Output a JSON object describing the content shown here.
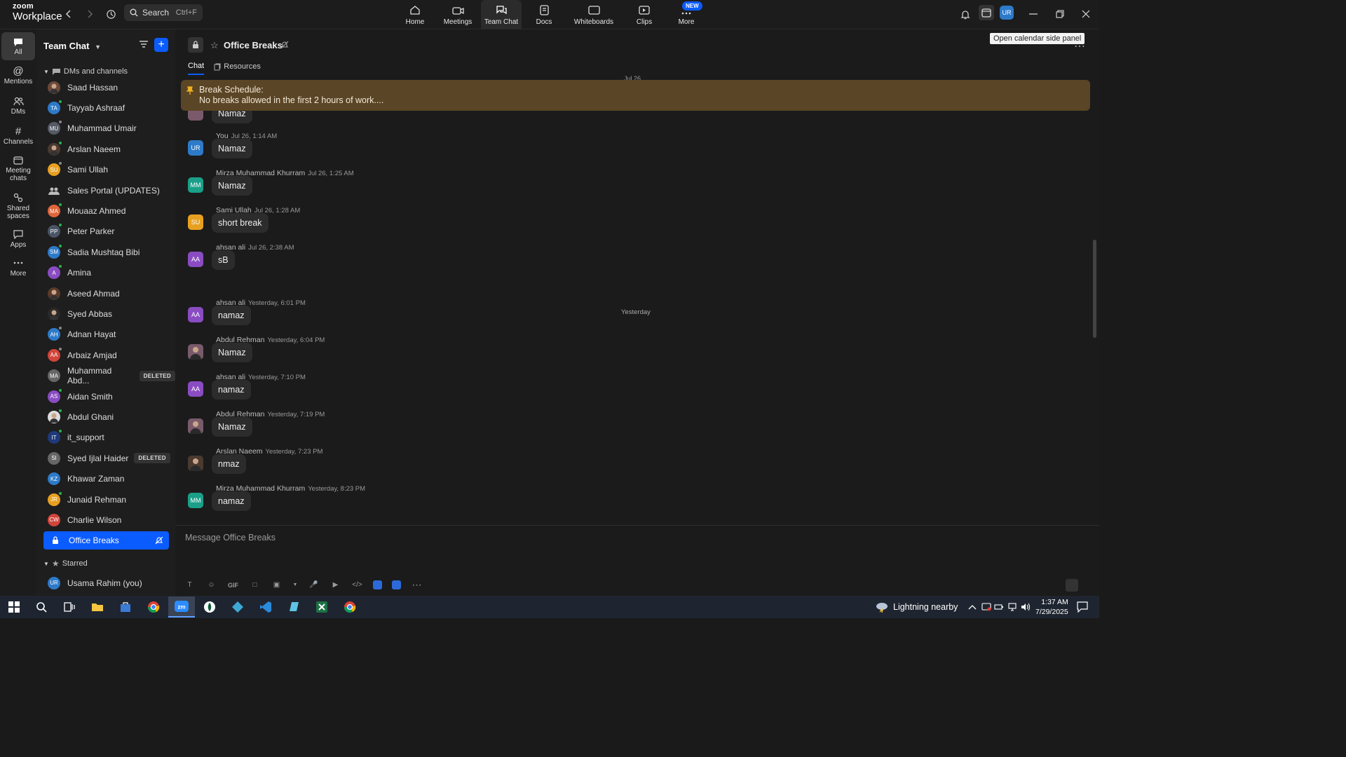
{
  "app": {
    "logo_line1": "zoom",
    "logo_line2": "Workplace",
    "search_label": "Search",
    "search_shortcut": "Ctrl+F",
    "nav": [
      {
        "label": "Home"
      },
      {
        "label": "Meetings"
      },
      {
        "label": "Team Chat"
      },
      {
        "label": "Docs"
      },
      {
        "label": "Whiteboards"
      },
      {
        "label": "Clips"
      },
      {
        "label": "More",
        "badge": "NEW"
      }
    ],
    "user_initials": "UR",
    "tooltip": "Open calendar side panel"
  },
  "rail": [
    {
      "label": "All"
    },
    {
      "label": "Mentions"
    },
    {
      "label": "DMs"
    },
    {
      "label": "Channels"
    },
    {
      "label": "Meeting chats"
    },
    {
      "label": "Shared spaces"
    },
    {
      "label": "Apps"
    },
    {
      "label": "More"
    }
  ],
  "sidebar": {
    "title": "Team Chat",
    "section_dms": "DMs and channels",
    "section_starred": "Starred",
    "contacts": [
      {
        "name": "Saad Hassan",
        "initials": "",
        "color": "#6b4a3a",
        "status": "",
        "photo": true
      },
      {
        "name": "Tayyab Ashraaf",
        "initials": "TA",
        "color": "#2d7ac9",
        "status": "#2bb24c"
      },
      {
        "name": "Muhammad Umair",
        "initials": "MU",
        "color": "#555a66",
        "status": "#888"
      },
      {
        "name": "Arslan Naeem",
        "initials": "",
        "color": "#4a3a30",
        "status": "#2bb24c",
        "photo": true
      },
      {
        "name": "Sami Ullah",
        "initials": "SU",
        "color": "#e8a020",
        "status": "#888"
      },
      {
        "name": "Sales Portal (UPDATES)",
        "initials": "",
        "color": "transparent",
        "status": "",
        "group": true
      },
      {
        "name": "Mouaaz Ahmed",
        "initials": "MA",
        "color": "#e0653a",
        "status": "#2bb24c"
      },
      {
        "name": "Peter Parker",
        "initials": "PP",
        "color": "#4a5566",
        "status": "#2bb24c"
      },
      {
        "name": "Sadia Mushtaq Bibi",
        "initials": "SM",
        "color": "#2d7ac9",
        "status": "#2bb24c"
      },
      {
        "name": "Amina",
        "initials": "A",
        "color": "#8a4cc2",
        "status": "#2bb24c"
      },
      {
        "name": "Aseed Ahmad",
        "initials": "",
        "color": "#5a3a2a",
        "status": "",
        "photo": true
      },
      {
        "name": "Syed Abbas",
        "initials": "",
        "color": "#2a2a2a",
        "status": "",
        "photo": true
      },
      {
        "name": "Adnan Hayat",
        "initials": "AH",
        "color": "#2d7ac9",
        "status": "#888"
      },
      {
        "name": "Arbaiz Amjad",
        "initials": "AA",
        "color": "#d2453a",
        "status": "#888"
      },
      {
        "name": "Muhammad Abd...",
        "initials": "MA",
        "color": "#666",
        "status": "",
        "badge": "DELETED"
      },
      {
        "name": "Aidan Smith",
        "initials": "AS",
        "color": "#8a4cc2",
        "status": "#2bb24c"
      },
      {
        "name": "Abdul Ghani",
        "initials": "",
        "color": "#ddd",
        "status": "#2bb24c",
        "photo": true
      },
      {
        "name": "it_support",
        "initials": "IT",
        "color": "#1f3a7a",
        "status": "#2bb24c"
      },
      {
        "name": "Syed Ijlal Haider",
        "initials": "SI",
        "color": "#666",
        "status": "",
        "badge": "DELETED"
      },
      {
        "name": "Khawar Zaman",
        "initials": "KZ",
        "color": "#2d7ac9",
        "status": ""
      },
      {
        "name": "Junaid Rehman",
        "initials": "JR",
        "color": "#e8a020",
        "status": "#2bb24c"
      },
      {
        "name": "Charlie Wilson",
        "initials": "CW",
        "color": "#d2453a",
        "status": ""
      }
    ],
    "selected": "Office Breaks",
    "starred_user": {
      "name": "Usama Rahim (you)",
      "initials": "UR"
    }
  },
  "channel": {
    "name": "Office Breaks",
    "tabs": [
      "Chat",
      "Resources"
    ],
    "pinned_title": "Break Schedule:",
    "pinned_text": "No breaks allowed in the first 2 hours of work....",
    "top_date": "Jul 26",
    "day_separator": "Yesterday",
    "composer_placeholder": "Message Office Breaks",
    "messages": [
      {
        "sender": "You",
        "time": "Jul 26, 1:14 AM",
        "text": "Namaz",
        "initials": "UR",
        "color": "#2d7ac9"
      },
      {
        "sender": "Mirza Muhammad Khurram",
        "time": "Jul 26, 1:25 AM",
        "text": "Namaz",
        "initials": "MM",
        "color": "#1aa089"
      },
      {
        "sender": "Sami Ullah",
        "time": "Jul 26, 1:28 AM",
        "text": "short break",
        "initials": "SU",
        "color": "#e8a020"
      },
      {
        "sender": "ahsan ali",
        "time": "Jul 26, 2:38 AM",
        "text": "sB",
        "initials": "AA",
        "color": "#8a4cc2"
      },
      {
        "sender": "ahsan ali",
        "time": "Yesterday, 6:01 PM",
        "text": "namaz",
        "initials": "AA",
        "color": "#8a4cc2"
      },
      {
        "sender": "Abdul Rehman",
        "time": "Yesterday, 6:04 PM",
        "text": "Namaz",
        "initials": "",
        "color": "#7a5a6a"
      },
      {
        "sender": "ahsan ali",
        "time": "Yesterday, 7:10 PM",
        "text": "namaz",
        "initials": "AA",
        "color": "#8a4cc2"
      },
      {
        "sender": "Abdul Rehman",
        "time": "Yesterday, 7:19 PM",
        "text": "Namaz",
        "initials": "",
        "color": "#7a5a6a"
      },
      {
        "sender": "Arslan Naeem",
        "time": "Yesterday, 7:23 PM",
        "text": "nmaz",
        "initials": "",
        "color": "#4a3a30"
      },
      {
        "sender": "Mirza Muhammad Khurram",
        "time": "Yesterday, 8:23 PM",
        "text": "namaz",
        "initials": "MM",
        "color": "#1aa089"
      }
    ],
    "partial_top_text": "Namaz"
  },
  "taskbar": {
    "weather": "Lightning nearby",
    "time": "1:37 AM",
    "date": "7/29/2025"
  }
}
